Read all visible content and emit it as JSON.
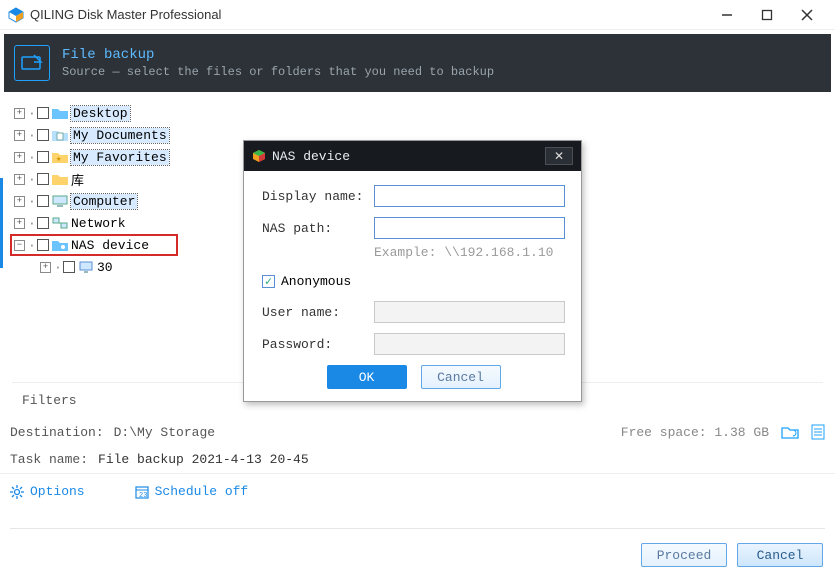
{
  "window": {
    "title": "QILING Disk Master Professional"
  },
  "header": {
    "title": "File backup",
    "subtitle": "Source — select the files or folders that you need to backup"
  },
  "tree": {
    "items": [
      {
        "label": "Desktop",
        "icon": "folder-blue",
        "selected": true
      },
      {
        "label": "My Documents",
        "icon": "folder-doc",
        "selected": true
      },
      {
        "label": "My Favorites",
        "icon": "folder-star",
        "selected": true
      },
      {
        "label": "库",
        "icon": "folder-yellow"
      },
      {
        "label": "Computer",
        "icon": "computer",
        "selected": true
      },
      {
        "label": "Network",
        "icon": "network"
      },
      {
        "label": "NAS device",
        "icon": "nas",
        "highlighted": true,
        "expanded": true,
        "children": [
          {
            "label": "30",
            "icon": "monitor"
          }
        ]
      }
    ]
  },
  "filters_label": "Filters",
  "destination": {
    "label": "Destination:",
    "value": "D:\\My Storage",
    "free_space_label": "Free space: 1.38 GB"
  },
  "task": {
    "label": "Task name:",
    "value": "File backup 2021-4-13 20-45"
  },
  "options": {
    "options_label": "Options",
    "schedule_label": "Schedule off"
  },
  "footer": {
    "proceed": "Proceed",
    "cancel": "Cancel"
  },
  "modal": {
    "title": "NAS device",
    "display_name_label": "Display name:",
    "nas_path_label": "NAS path:",
    "example_label": "Example: \\\\192.168.1.10",
    "anonymous_label": "Anonymous",
    "username_label": "User name:",
    "password_label": "Password:",
    "ok": "OK",
    "cancel": "Cancel",
    "display_name_value": "",
    "nas_path_value": "",
    "anonymous_checked": true,
    "username_value": "",
    "password_value": ""
  }
}
